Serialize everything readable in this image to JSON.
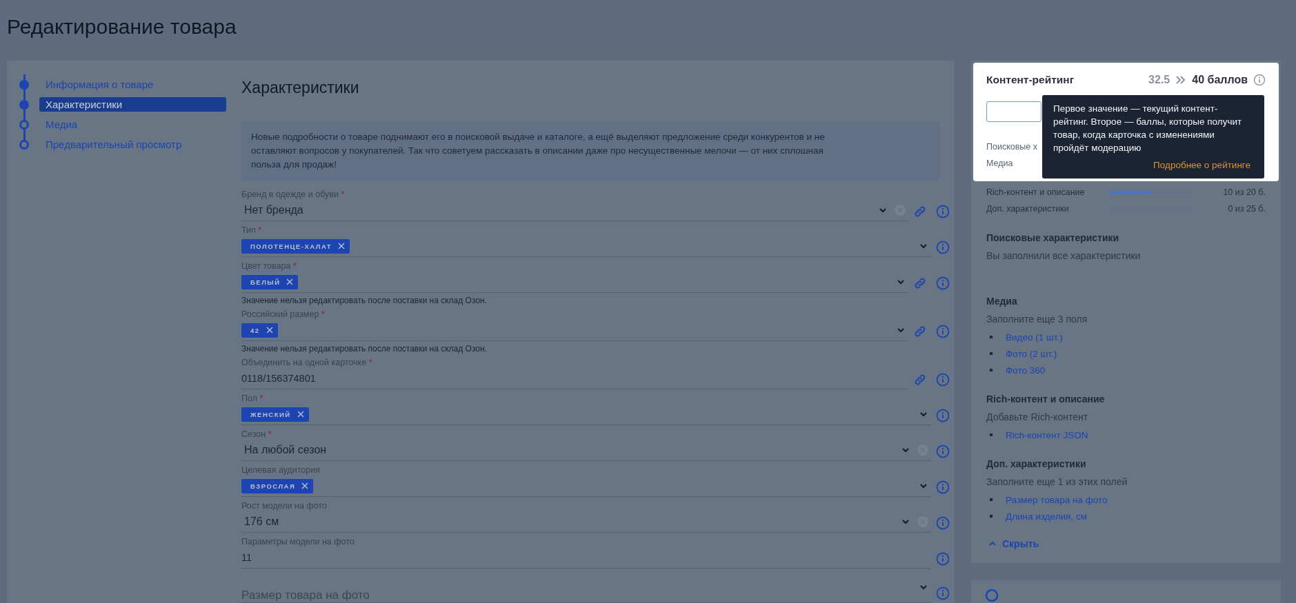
{
  "page": {
    "title": "Редактирование товара"
  },
  "nav": {
    "items": [
      {
        "label": "Информация о товаре",
        "completed": true,
        "selected": false
      },
      {
        "label": "Характеристики",
        "completed": true,
        "selected": true
      },
      {
        "label": "Медиа",
        "completed": false,
        "selected": false
      },
      {
        "label": "Предварительный просмотр",
        "completed": false,
        "selected": false
      }
    ]
  },
  "section": {
    "title": "Характеристики",
    "notice": "Новые подробности о товаре поднимают его в поисковой выдаче и каталоге, а ещё выделяют предложение среди конкурентов и не оставляют вопросов у покупателей. Так что советуем рассказать в описании даже про несущественные мелочи — от них сплошная польза для продаж!"
  },
  "fields": [
    {
      "label": "Бренд в одежде и обуви",
      "required_mark": "*",
      "value": "Нет бренда",
      "clearable": true,
      "linked": true
    },
    {
      "label": "Тип",
      "required_mark": "*",
      "chips": [
        "ПОЛОТЕНЦЕ-ХАЛАТ"
      ],
      "clearable": false,
      "linked": false
    },
    {
      "label": "Цвет товара",
      "required_mark": "*",
      "chips": [
        "БЕЛЫЙ"
      ],
      "clearable": false,
      "linked": true,
      "note": "Значение нельзя редактировать после поставки на склад Озон."
    },
    {
      "label": "Российский размер",
      "required_mark": "*",
      "chips": [
        "42"
      ],
      "clearable": false,
      "linked": true,
      "note": "Значение нельзя редактировать после поставки на склад Озон."
    },
    {
      "label": "Объединить на одной карточке",
      "required_mark": "*",
      "value": "0118/156374801",
      "kind": "text",
      "clearable": false,
      "linked": true
    },
    {
      "label": "Пол",
      "required_mark": "*",
      "chips": [
        "ЖЕНСКИЙ"
      ],
      "clearable": false,
      "linked": false
    },
    {
      "label": "Сезон",
      "required_mark": "*",
      "value": "На любой сезон",
      "clearable": true,
      "linked": false
    },
    {
      "label": "Целевая аудитория",
      "chips": [
        "ВЗРОСЛАЯ"
      ],
      "clearable": false,
      "linked": false
    },
    {
      "label": "Рост модели на фото",
      "value": "176 см",
      "clearable": true,
      "linked": false
    },
    {
      "label": "Параметры модели на фото",
      "value": "11",
      "kind": "text",
      "clearable": false,
      "linked": false
    },
    {
      "placeholder": "Размер товара на фото",
      "clearable": false,
      "linked": false
    }
  ],
  "rating": {
    "title": "Контент-рейтинг",
    "current": "32.5",
    "target": "40 баллов",
    "highlighted_rows": [
      {
        "label": "Поисковые х"
      },
      {
        "label": "Медиа"
      }
    ],
    "rows": [
      {
        "label": "Rich-контент и описание",
        "level": 0.5,
        "value": "10 из 20 б."
      },
      {
        "label": "Доп. характеристики",
        "level": 0,
        "value": "0 из 25 б."
      }
    ],
    "tooltip": {
      "text": "Первое значение — текущий контент-рейтинг. Второе — баллы, которые получит товар, когда карточка с изменениями пройдёт модерацию",
      "link": "Подробнее о рейтинге"
    },
    "groups": [
      {
        "title": "Поисковые характеристики",
        "hint": "Вы заполнили все характеристики"
      },
      {
        "title": "Медиа",
        "hint": "Заполните еще 3 поля",
        "links": [
          "Видео (1 шт.)",
          "Фото (2 шт.)",
          "Фото 360"
        ]
      },
      {
        "title": "Rich-контент и описание",
        "hint": "Добавьте Rich-контент",
        "links": [
          "Rich-контент JSON"
        ]
      },
      {
        "title": "Доп. характеристики",
        "hint": "Заполните еще 1 из этих полей",
        "links": [
          "Размер товара на фото",
          "Длина изделия, см"
        ]
      }
    ],
    "collapse": "Скрыть"
  }
}
